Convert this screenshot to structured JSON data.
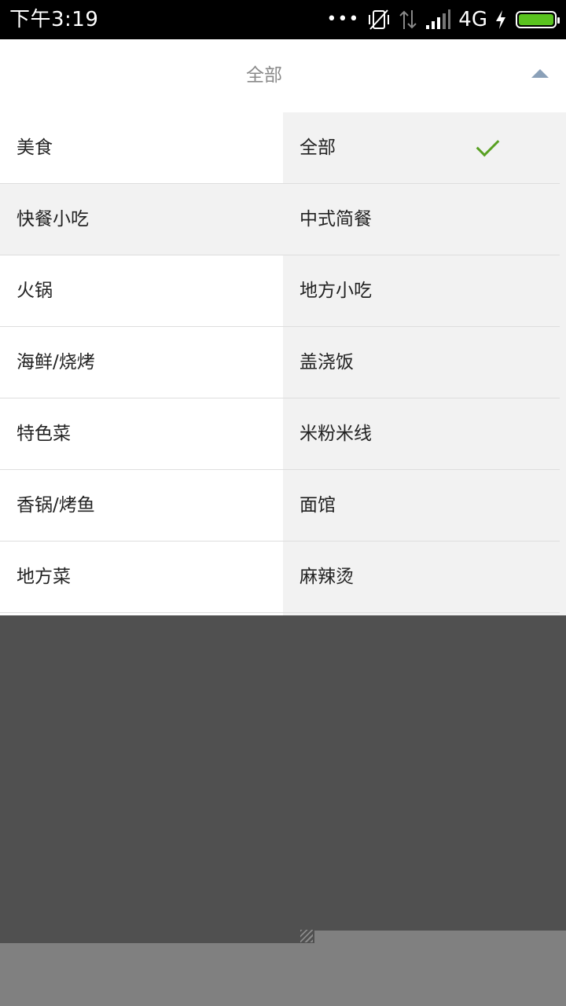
{
  "status_bar": {
    "time": "下午3:19",
    "dots": "•••",
    "network": "4G",
    "battery_color": "#5ac31f"
  },
  "filter": {
    "title": "全部"
  },
  "categories": [
    {
      "label": "美食"
    },
    {
      "label": "快餐小吃"
    },
    {
      "label": "火锅"
    },
    {
      "label": "海鲜/烧烤"
    },
    {
      "label": "特色菜"
    },
    {
      "label": "香锅/烤鱼"
    },
    {
      "label": "地方菜"
    }
  ],
  "subcategories": [
    {
      "label": "全部",
      "selected": true
    },
    {
      "label": "中式简餐"
    },
    {
      "label": "地方小吃"
    },
    {
      "label": "盖浇饭"
    },
    {
      "label": "米粉米线"
    },
    {
      "label": "面馆"
    },
    {
      "label": "麻辣烫"
    }
  ],
  "colors": {
    "check": "#58a022",
    "overlay": "#505050",
    "arrow": "#8aa0b8"
  }
}
